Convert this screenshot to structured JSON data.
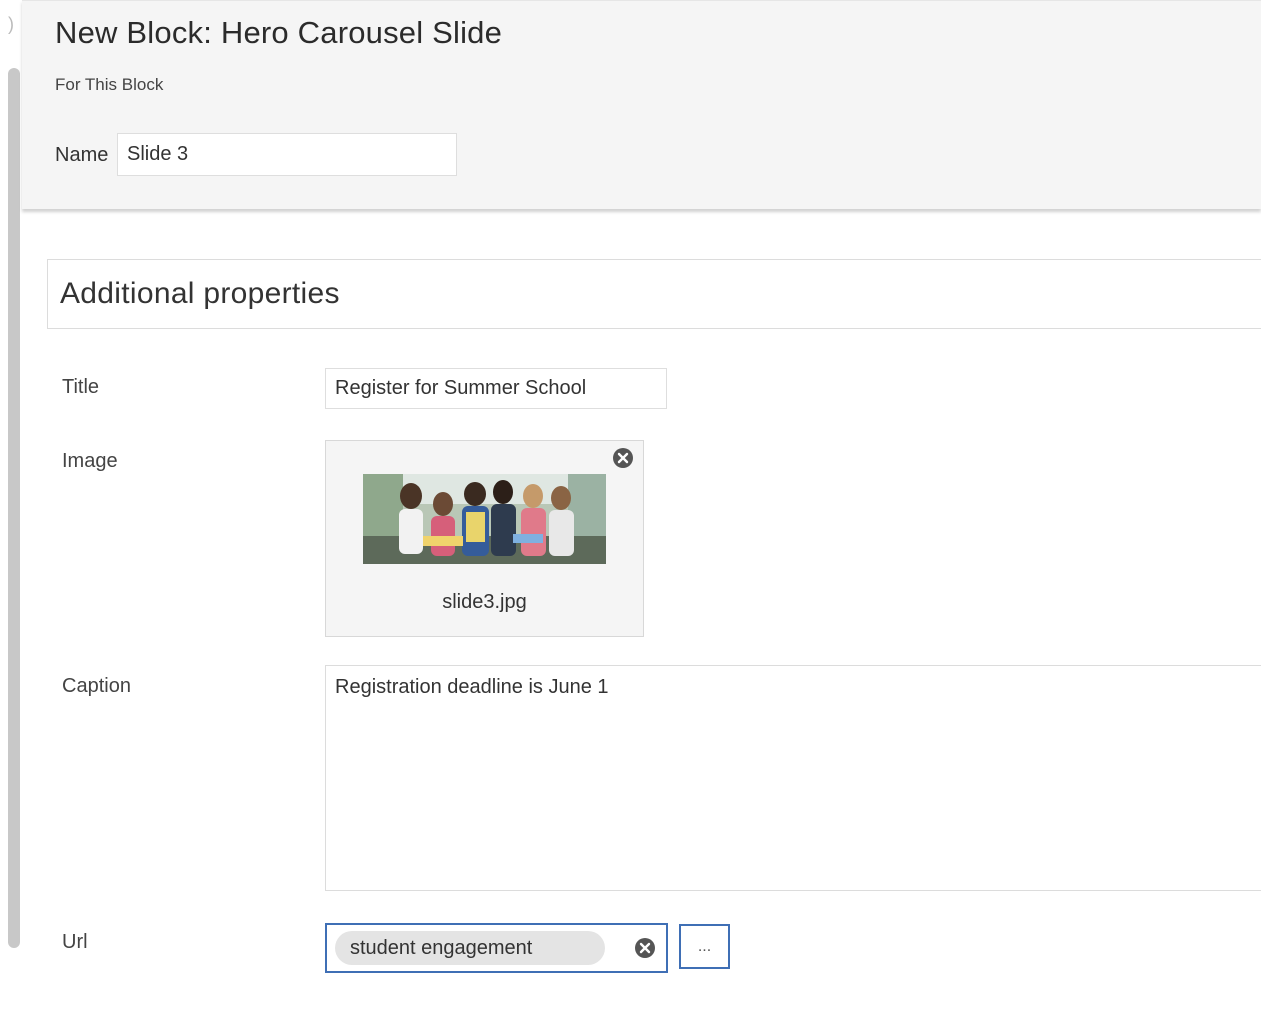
{
  "header": {
    "title": "New Block: Hero Carousel Slide",
    "subtitle": "For This Block",
    "name_label": "Name",
    "name_value": "Slide 3"
  },
  "section": {
    "title": "Additional properties"
  },
  "fields": {
    "title": {
      "label": "Title",
      "value": "Register for Summer School"
    },
    "image": {
      "label": "Image",
      "file_name": "slide3.jpg",
      "remove_icon": "close-circle-icon"
    },
    "caption": {
      "label": "Caption",
      "value": "Registration deadline is June 1"
    },
    "url": {
      "label": "Url",
      "chip_text": "student engagement",
      "remove_icon": "close-circle-icon",
      "browse_label": "..."
    }
  },
  "colors": {
    "header_bg": "#f5f5f5",
    "focus_border": "#3f6fb5",
    "chip_bg": "#e4e4e4",
    "remove_icon": "#555555"
  }
}
